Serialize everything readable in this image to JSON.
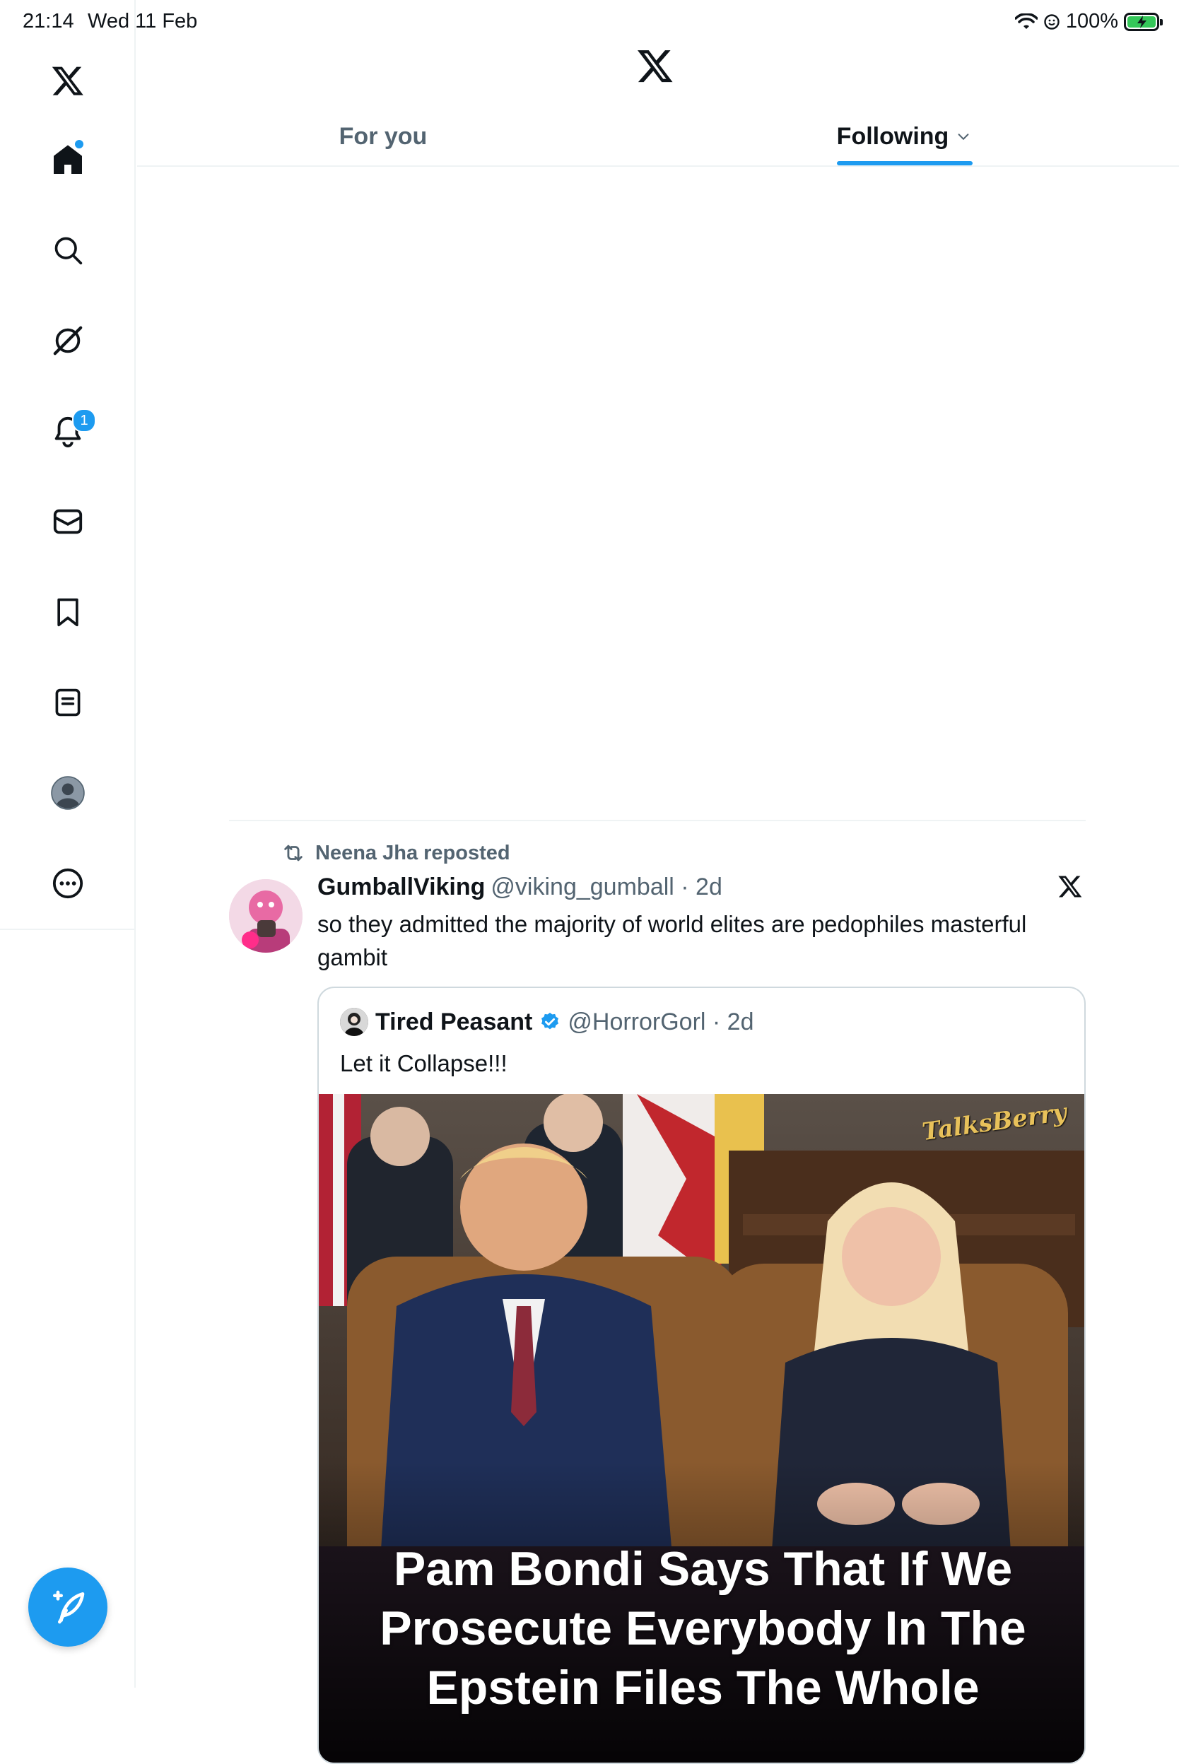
{
  "status_bar": {
    "time": "21:14",
    "date": "Wed 11 Feb",
    "battery": "100%"
  },
  "sidebar": {
    "items": [
      {
        "name": "home",
        "icon": "home-icon",
        "has_dot": true
      },
      {
        "name": "search",
        "icon": "search-icon"
      },
      {
        "name": "grok",
        "icon": "grok-icon"
      },
      {
        "name": "notifications",
        "icon": "bell-icon",
        "badge": "1"
      },
      {
        "name": "messages",
        "icon": "envelope-icon"
      },
      {
        "name": "bookmarks",
        "icon": "bookmark-icon"
      },
      {
        "name": "lists",
        "icon": "list-icon"
      },
      {
        "name": "profile",
        "icon": "avatar-icon"
      },
      {
        "name": "more",
        "icon": "more-icon"
      }
    ]
  },
  "tabs": {
    "for_you": "For you",
    "following": "Following"
  },
  "post": {
    "repost_label": "Neena Jha reposted",
    "author_name": "GumballViking",
    "author_meta": "@viking_gumball · 2d",
    "text": "so they admitted the majority of world elites are pedophiles masterful gambit",
    "quote": {
      "author_name": "Tired Peasant",
      "author_meta": "@HorrorGorl · 2d",
      "text": "Let it  Collapse!!!",
      "media_caption_line1": "Pam Bondi Says That If We",
      "media_caption_line2": "Prosecute Everybody In The",
      "media_caption_line3": "Epstein Files The Whole",
      "watermark": "TalksBerry"
    }
  },
  "colors": {
    "accent": "#1d9bf0",
    "text": "#0f1419",
    "muted": "#536471",
    "border": "#eff3f4"
  }
}
